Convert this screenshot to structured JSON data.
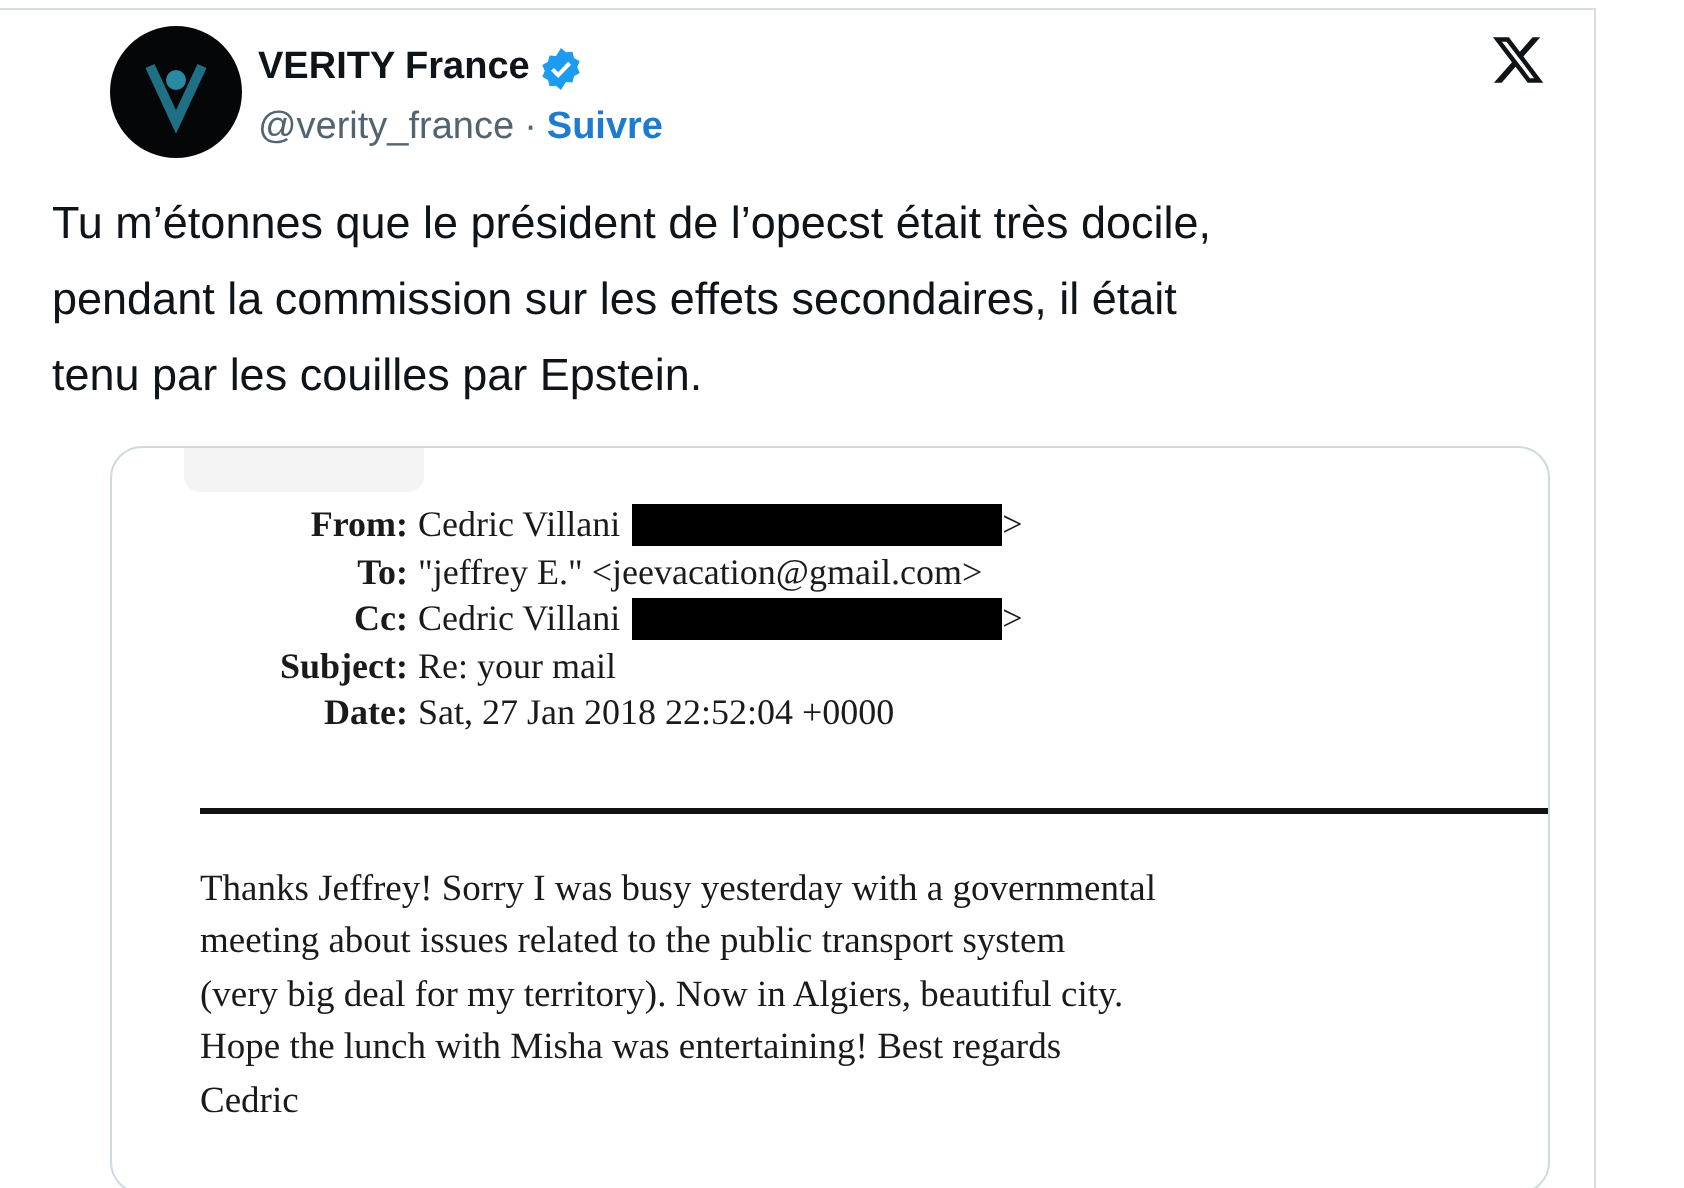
{
  "account": {
    "name": "VERITY France",
    "verified": true,
    "handle": "@verity_france",
    "separator": "·",
    "follow": "Suivre"
  },
  "tweet_text": "Tu m’étonnes que le président de l’opecst était très docile,\npendant la commission sur les effets secondaires, il était\ntenu par les couilles par Epstein.",
  "document": {
    "headers": [
      {
        "label": "From:",
        "value": "Cedric Villani",
        "redacted": true,
        "suffix": ">"
      },
      {
        "label": "To:",
        "value": "\"jeffrey E.\" <jeevacation@gmail.com>"
      },
      {
        "label": "Cc:",
        "value": "Cedric Villani",
        "redacted": true,
        "suffix": ">"
      },
      {
        "label": "Subject:",
        "value": "Re: your mail"
      },
      {
        "label": "Date:",
        "value": "Sat, 27 Jan 2018 22:52:04 +0000"
      }
    ],
    "body": "Thanks Jeffrey! Sorry I was busy yesterday with a governmental\nmeeting about issues related to the public transport system\n(very big deal for my territory). Now in Algiers, beautiful city.\nHope the lunch with Misha was entertaining! Best regards\nCedric"
  }
}
